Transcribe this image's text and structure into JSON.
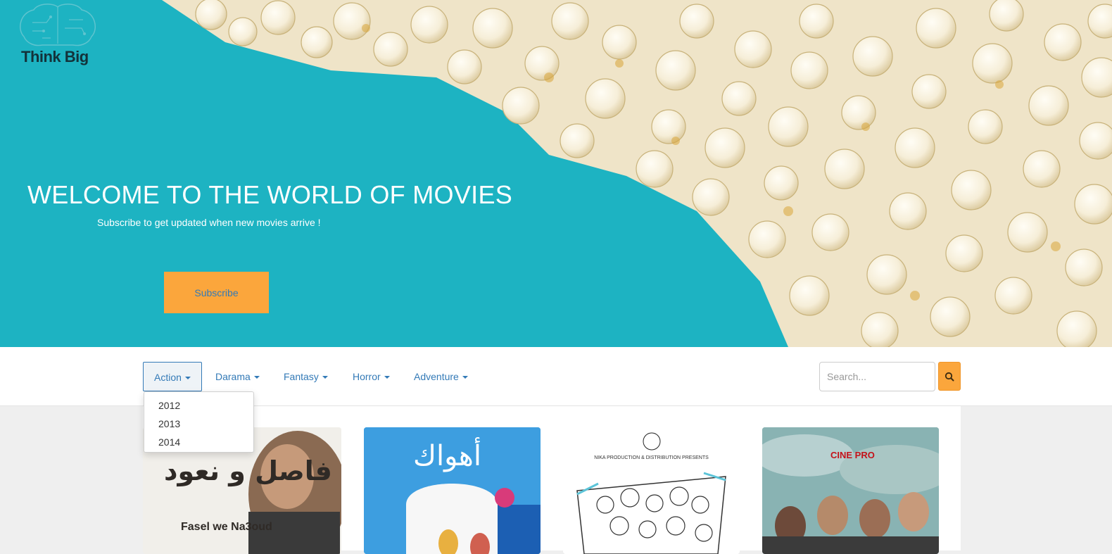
{
  "brand": {
    "name": "Think Big"
  },
  "hero": {
    "title": "WELCOME TO THE WORLD OF MOVIES",
    "subtitle": "Subscribe to get updated when new movies arrive !",
    "subscribe_label": "Subscribe"
  },
  "nav": {
    "items": [
      {
        "label": "Action"
      },
      {
        "label": "Darama"
      },
      {
        "label": "Fantasy"
      },
      {
        "label": "Horror"
      },
      {
        "label": "Adventure"
      }
    ],
    "dropdown": [
      "2012",
      "2013",
      "2014"
    ]
  },
  "search": {
    "placeholder": "Search...",
    "icon": "search-icon"
  },
  "posters": [
    {
      "title_ar": "فاصل و نعود",
      "title_en": "Fasel we Na3oud"
    },
    {
      "title_ar": "أهواك"
    },
    {
      "header": "NIKA PRODUCTION & DISTRIBUTION PRESENTS"
    },
    {
      "brand": "CINE PRO"
    }
  ],
  "colors": {
    "hero_bg": "#1db3c2",
    "accent": "#fba63c",
    "link": "#337ab7"
  }
}
